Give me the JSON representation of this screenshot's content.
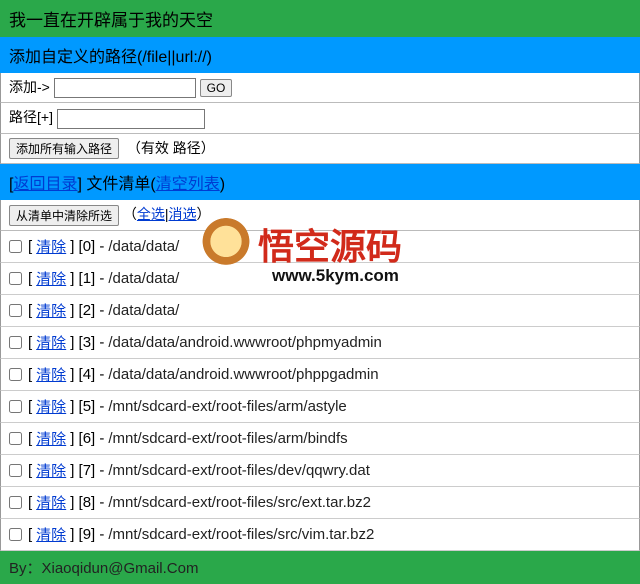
{
  "header": {
    "title": "我一直在开辟属于我的天空"
  },
  "addSection": {
    "title": "添加自定义的路径(/file||url://)",
    "addLabel": "添加->",
    "goLabel": "GO",
    "pathLabel": "路径[+]",
    "addAllBtn": "添加所有输入路径",
    "validText": "（有效 路径）"
  },
  "listHeader": {
    "backLink": "返回目录",
    "listLabel": "文件清单",
    "clearLink": "清空列表"
  },
  "listToolbar": {
    "removeSelected": "从清单中清除所选",
    "open": "（",
    "selectAll": "全选",
    "sep": "|",
    "deselect": "消选",
    "close": "）"
  },
  "rowLabel": "清除",
  "files": [
    {
      "idx": 0,
      "path": "/data/data/"
    },
    {
      "idx": 1,
      "path": "/data/data/"
    },
    {
      "idx": 2,
      "path": "/data/data/"
    },
    {
      "idx": 3,
      "path": "/data/data/android.wwwroot/phpmyadmin"
    },
    {
      "idx": 4,
      "path": "/data/data/android.wwwroot/phppgadmin"
    },
    {
      "idx": 5,
      "path": "/mnt/sdcard-ext/root-files/arm/astyle"
    },
    {
      "idx": 6,
      "path": "/mnt/sdcard-ext/root-files/arm/bindfs"
    },
    {
      "idx": 7,
      "path": "/mnt/sdcard-ext/root-files/dev/qqwry.dat"
    },
    {
      "idx": 8,
      "path": "/mnt/sdcard-ext/root-files/src/ext.tar.bz2"
    },
    {
      "idx": 9,
      "path": "/mnt/sdcard-ext/root-files/src/vim.tar.bz2"
    }
  ],
  "footer": {
    "text": "By：Xiaoqidun@Gmail.Com"
  },
  "watermark": {
    "text": "悟空源码",
    "url": "www.5kym.com"
  }
}
